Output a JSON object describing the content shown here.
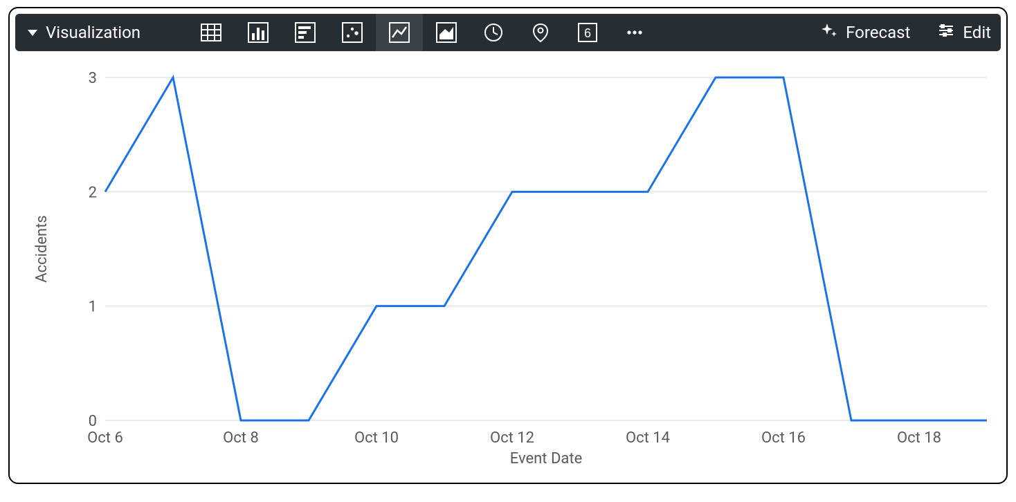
{
  "toolbar": {
    "title": "Visualization",
    "forecast_label": "Forecast",
    "edit_label": "Edit",
    "icons": [
      {
        "name": "table-icon"
      },
      {
        "name": "column-chart-icon"
      },
      {
        "name": "bar-chart-icon"
      },
      {
        "name": "scatter-chart-icon"
      },
      {
        "name": "line-chart-icon",
        "selected": true
      },
      {
        "name": "area-chart-icon"
      },
      {
        "name": "timeline-icon"
      },
      {
        "name": "map-pin-icon"
      },
      {
        "name": "single-value-icon"
      },
      {
        "name": "more-icon"
      }
    ]
  },
  "chart_data": {
    "type": "line",
    "title": "",
    "xlabel": "Event Date",
    "ylabel": "Accidents",
    "x_tick_labels": [
      "Oct 6",
      "Oct 8",
      "Oct 10",
      "Oct 12",
      "Oct 14",
      "Oct 16",
      "Oct 18"
    ],
    "x_tick_positions": [
      0,
      2,
      4,
      6,
      8,
      10,
      12
    ],
    "y_tick_labels": [
      "0",
      "1",
      "2",
      "3"
    ],
    "y_tick_values": [
      0,
      1,
      2,
      3
    ],
    "ylim": [
      0,
      3
    ],
    "x_index_range": [
      0,
      13
    ],
    "categories": [
      "Oct 6",
      "Oct 7",
      "Oct 8",
      "Oct 9",
      "Oct 10",
      "Oct 11",
      "Oct 12",
      "Oct 13",
      "Oct 14",
      "Oct 15",
      "Oct 16",
      "Oct 17",
      "Oct 18",
      "Oct 19"
    ],
    "values": [
      2,
      3,
      0,
      0,
      1,
      1,
      2,
      2,
      2,
      3,
      3,
      0,
      0,
      0
    ],
    "line_color": "#1a73e8"
  }
}
